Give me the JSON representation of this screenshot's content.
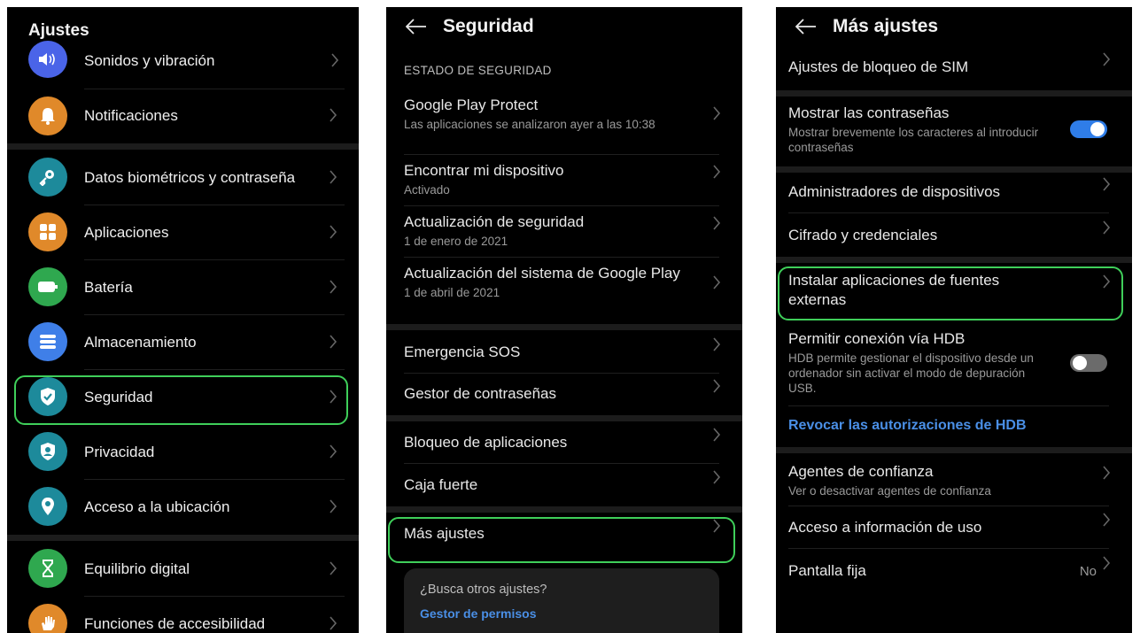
{
  "panel1": {
    "title": "Ajustes",
    "items": [
      {
        "label": "Sonidos y vibración",
        "icon": "speaker-icon",
        "color": "#4a64e8"
      },
      {
        "label": "Notificaciones",
        "icon": "bell-icon",
        "color": "#e0892a"
      },
      {
        "label": "Datos biométricos y contraseña",
        "icon": "key-icon",
        "color": "#1d8a9b"
      },
      {
        "label": "Aplicaciones",
        "icon": "apps-grid-icon",
        "color": "#e0892a"
      },
      {
        "label": "Batería",
        "icon": "battery-icon",
        "color": "#2fa84f"
      },
      {
        "label": "Almacenamiento",
        "icon": "storage-icon",
        "color": "#3f7fe8"
      },
      {
        "label": "Seguridad",
        "icon": "shield-check-icon",
        "color": "#1d8a9b"
      },
      {
        "label": "Privacidad",
        "icon": "privacy-shield-icon",
        "color": "#1d8a9b"
      },
      {
        "label": "Acceso a la ubicación",
        "icon": "location-pin-icon",
        "color": "#1d8a9b"
      },
      {
        "label": "Equilibrio digital",
        "icon": "hourglass-icon",
        "color": "#2fa84f"
      },
      {
        "label": "Funciones de accesibilidad",
        "icon": "hand-icon",
        "color": "#e0892a"
      }
    ]
  },
  "panel2": {
    "title": "Seguridad",
    "section_header": "ESTADO DE SEGURIDAD",
    "status_items": [
      {
        "label": "Google Play Protect",
        "sub": "Las aplicaciones se analizaron ayer a las 10:38"
      },
      {
        "label": "Encontrar mi dispositivo",
        "sub": "Activado"
      },
      {
        "label": "Actualización de seguridad",
        "sub": "1 de enero de 2021"
      },
      {
        "label": "Actualización del sistema de Google Play",
        "sub": "1 de abril de 2021"
      }
    ],
    "group2": [
      {
        "label": "Emergencia SOS"
      },
      {
        "label": "Gestor de contraseñas"
      }
    ],
    "group3": [
      {
        "label": "Bloqueo de aplicaciones"
      },
      {
        "label": "Caja fuerte"
      }
    ],
    "more": {
      "label": "Más ajustes"
    },
    "card": {
      "question": "¿Busca otros ajustes?",
      "link": "Gestor de permisos"
    }
  },
  "panel3": {
    "title": "Más ajustes",
    "sim_lock": "Ajustes de bloqueo de SIM",
    "show_passwords": {
      "label": "Mostrar las contraseñas",
      "sub": "Mostrar brevemente los caracteres al introducir contraseñas",
      "on": true
    },
    "device_admins": "Administradores de dispositivos",
    "encryption": "Cifrado y credenciales",
    "install_external": "Instalar aplicaciones de fuentes externas",
    "hdb": {
      "label": "Permitir conexión vía HDB",
      "sub": "HDB permite gestionar el dispositivo desde un ordenador sin activar el modo de depuración USB.",
      "on": false
    },
    "revoke_hdb": "Revocar las autorizaciones de HDB",
    "trust_agents": {
      "label": "Agentes de confianza",
      "sub": "Ver o desactivar agentes de confianza"
    },
    "usage_access": "Acceso a información de uso",
    "screen_pinning": {
      "label": "Pantalla fija",
      "value": "No"
    }
  },
  "colors": {
    "highlight": "#3fcf5a",
    "toggle_on": "#2f7de8",
    "link": "#4a8fe6"
  }
}
